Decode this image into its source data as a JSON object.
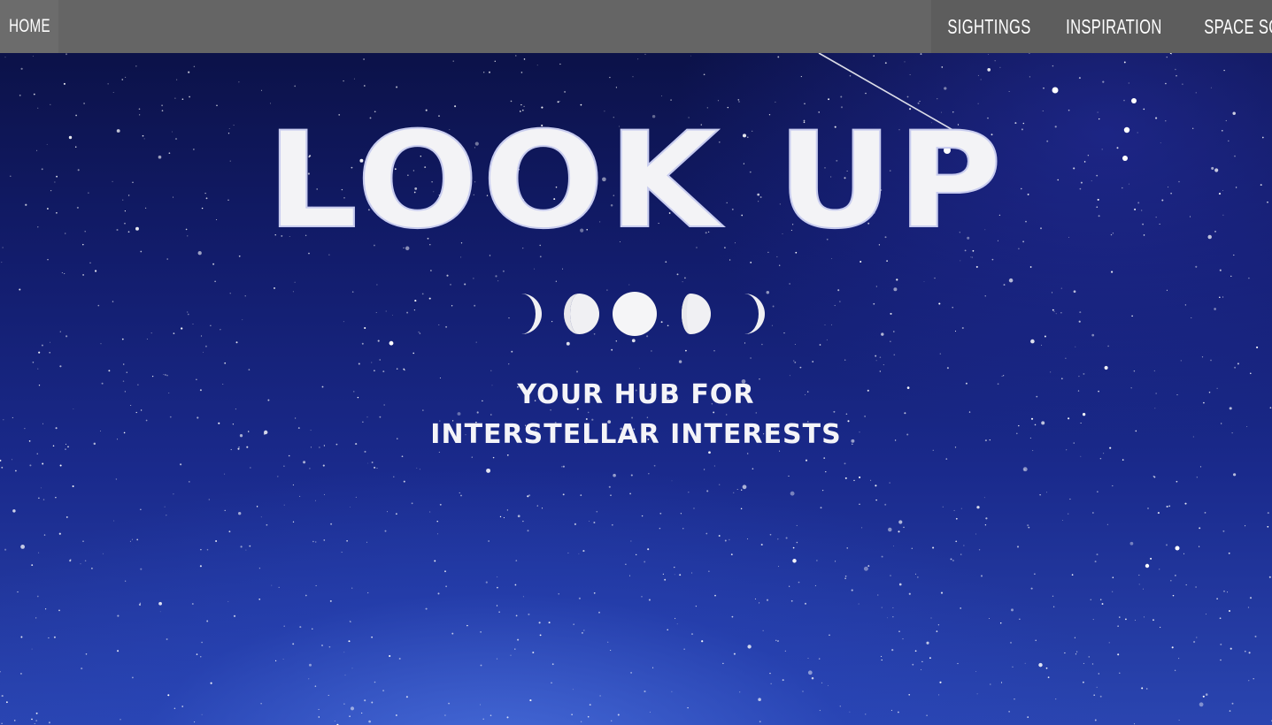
{
  "nav": {
    "home_label": "HOME",
    "links": [
      {
        "label": "SIGHTINGS"
      },
      {
        "label": "INSPIRATION"
      },
      {
        "label": "SPACE SOUNDS"
      }
    ]
  },
  "hero": {
    "title": "LOOK UP",
    "tagline_line1": "YOUR HUB FOR",
    "tagline_line2": "INTERSTELLAR INTERESTS",
    "moon_phases": [
      "waxing-crescent",
      "waxing-gibbous",
      "full-moon",
      "waning-gibbous",
      "waning-crescent"
    ]
  },
  "colors": {
    "nav_bg": "#656565",
    "nav_text": "#ffffff",
    "sky_dark": "#0a0f3f",
    "sky_light": "#2a45b0",
    "title_text": "#f3f3f6"
  }
}
